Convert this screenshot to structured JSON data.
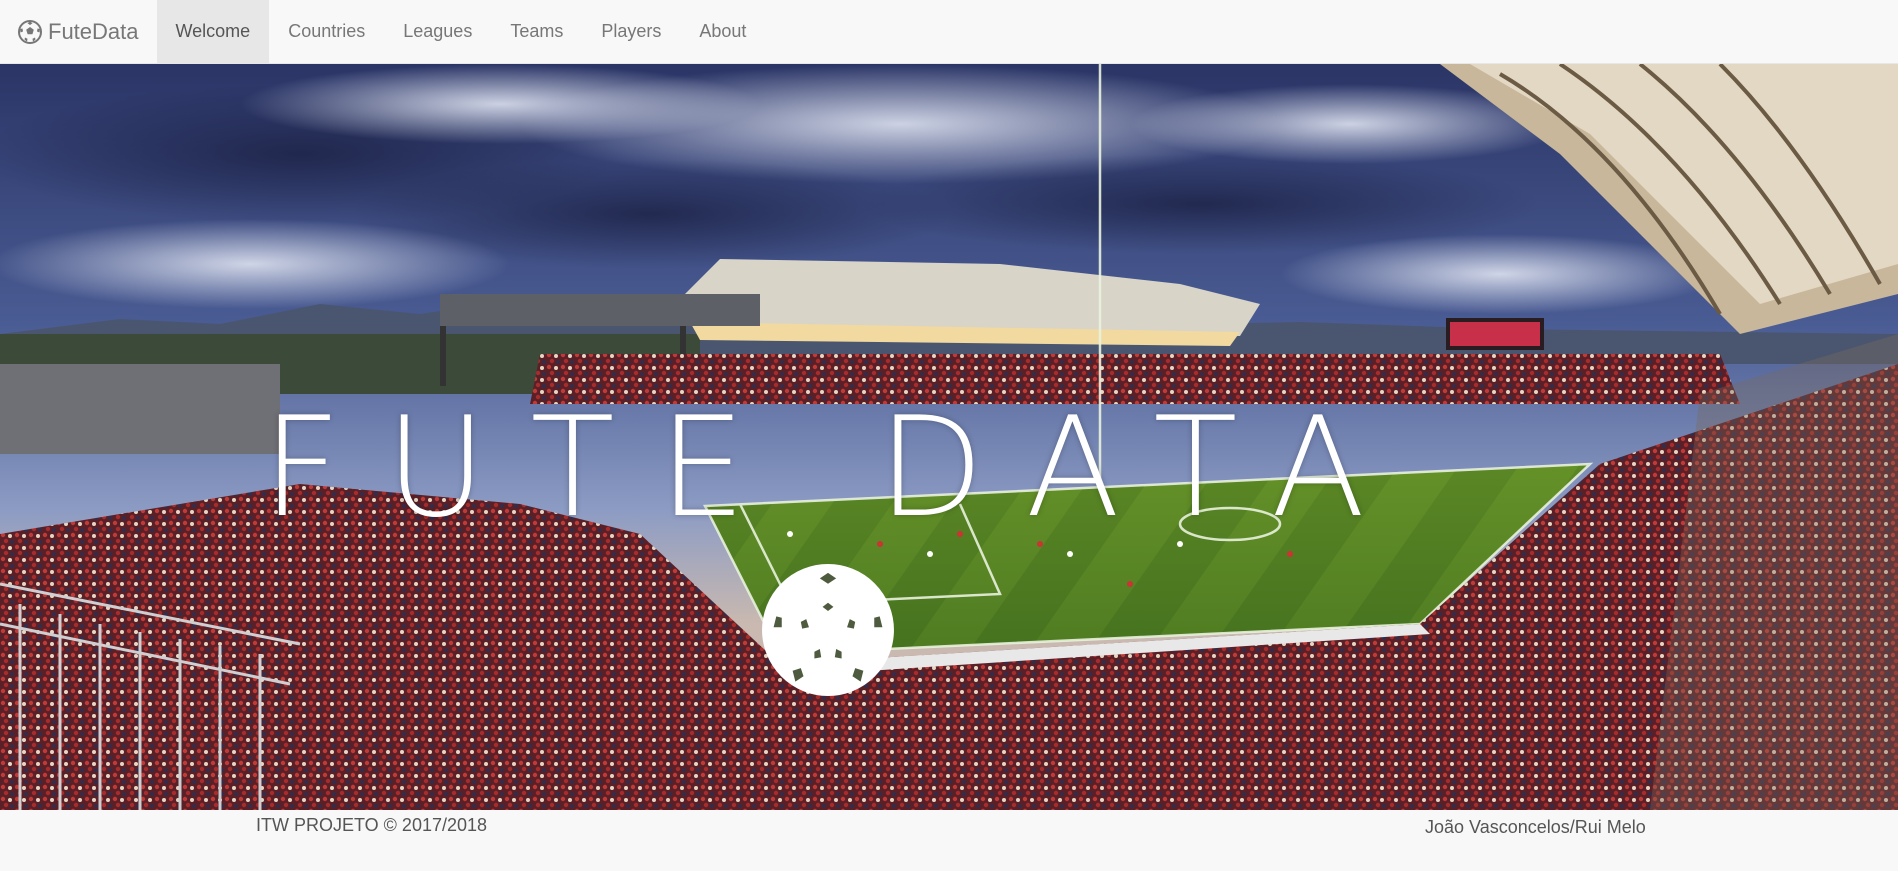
{
  "brand": {
    "name": "FuteData",
    "icon": "soccer-ball-icon"
  },
  "nav": {
    "items": [
      {
        "label": "Welcome",
        "active": true
      },
      {
        "label": "Countries",
        "active": false
      },
      {
        "label": "Leagues",
        "active": false
      },
      {
        "label": "Teams",
        "active": false
      },
      {
        "label": "Players",
        "active": false
      },
      {
        "label": "About",
        "active": false
      }
    ]
  },
  "hero": {
    "title": "FUTE DATA",
    "icon": "soccer-ball-icon"
  },
  "footer": {
    "left_text": "ITW PROJETO © 2017/2018",
    "right_text": "João Vasconcelos/Rui Melo"
  },
  "colors": {
    "navbar_bg": "#f8f8f8",
    "nav_active_bg": "#e7e7e7",
    "nav_text": "#777777",
    "pitch": "#4f7a22",
    "sky": "#3b4a7a"
  }
}
